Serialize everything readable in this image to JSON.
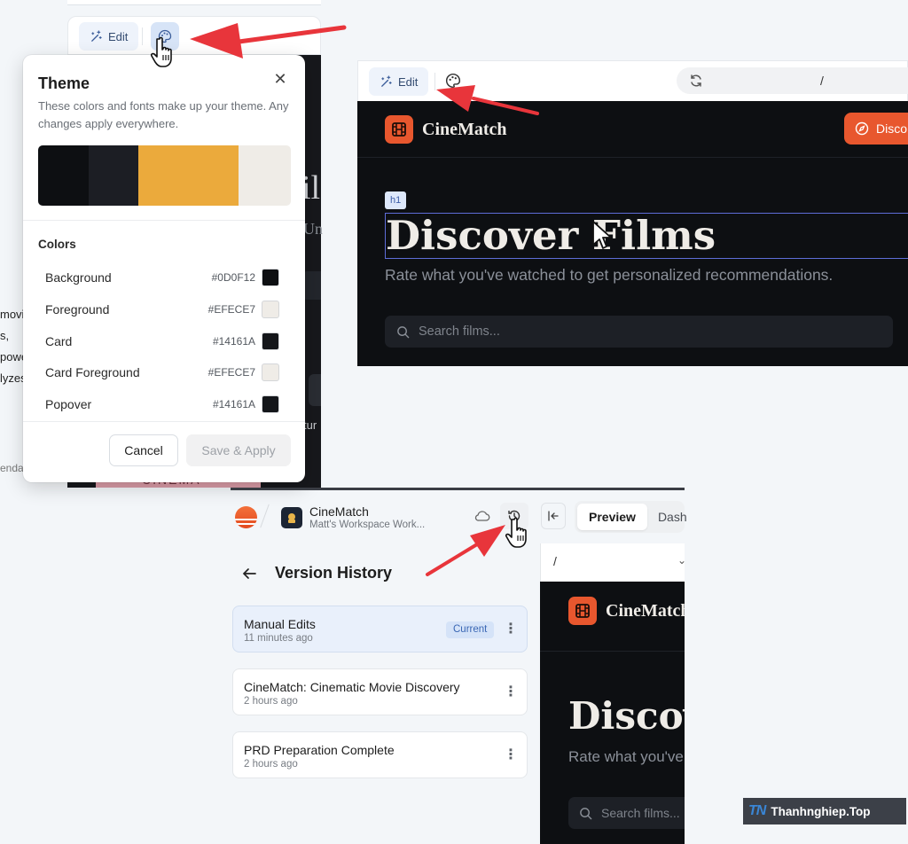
{
  "panel1": {
    "edit_label": "Edit",
    "ghost_letters": [
      "il",
      "Un",
      "tur"
    ],
    "side_text": [
      "movi",
      "s,",
      "powe",
      "lyzes",
      "enda"
    ],
    "theme": {
      "title": "Theme",
      "description": "These colors and fonts make up your theme. Any changes apply everywhere.",
      "swatch_colors": [
        "#0D0F12",
        "#1C1E24",
        "#EBAA3C",
        "#EFECE7"
      ],
      "colors_heading": "Colors",
      "colors": [
        {
          "name": "Background",
          "hex": "#0D0F12"
        },
        {
          "name": "Foreground",
          "hex": "#EFECE7"
        },
        {
          "name": "Card",
          "hex": "#14161A"
        },
        {
          "name": "Card Foreground",
          "hex": "#EFECE7"
        },
        {
          "name": "Popover",
          "hex": "#14161A"
        }
      ],
      "cancel_label": "Cancel",
      "save_label": "Save & Apply"
    },
    "cinema_text": "CINEMA"
  },
  "panel2": {
    "edit_label": "Edit",
    "url_path": "/",
    "brand": "CineMatch",
    "discover_button": "Disco",
    "h1_tag": "h1",
    "hero_title": "Discover Films",
    "hero_subtitle": "Rate what you've watched to get personalized recommendations.",
    "search_placeholder": "Search films..."
  },
  "panel3": {
    "project_name": "CineMatch",
    "workspace": "Matt's Workspace Work...",
    "tab_preview": "Preview",
    "tab_dashboard": "Dash",
    "title": "Version History",
    "versions": [
      {
        "name": "Manual Edits",
        "time": "11 minutes ago",
        "badge": "Current"
      },
      {
        "name": "CineMatch: Cinematic Movie Discovery",
        "time": "2 hours ago"
      },
      {
        "name": "PRD Preparation Complete",
        "time": "2 hours ago"
      }
    ],
    "preview": {
      "url_path": "/",
      "brand": "CineMatch",
      "hero_title": "Discover Films",
      "hero_subtitle": "Rate what you've watched",
      "search_placeholder": "Search films..."
    }
  },
  "watermark": {
    "logo": "TN",
    "text": "Thanhnghiep.Top"
  },
  "colors": {
    "accent": "#E8572E",
    "arrow": "#E8353B",
    "selection": "#5E6DD8"
  }
}
